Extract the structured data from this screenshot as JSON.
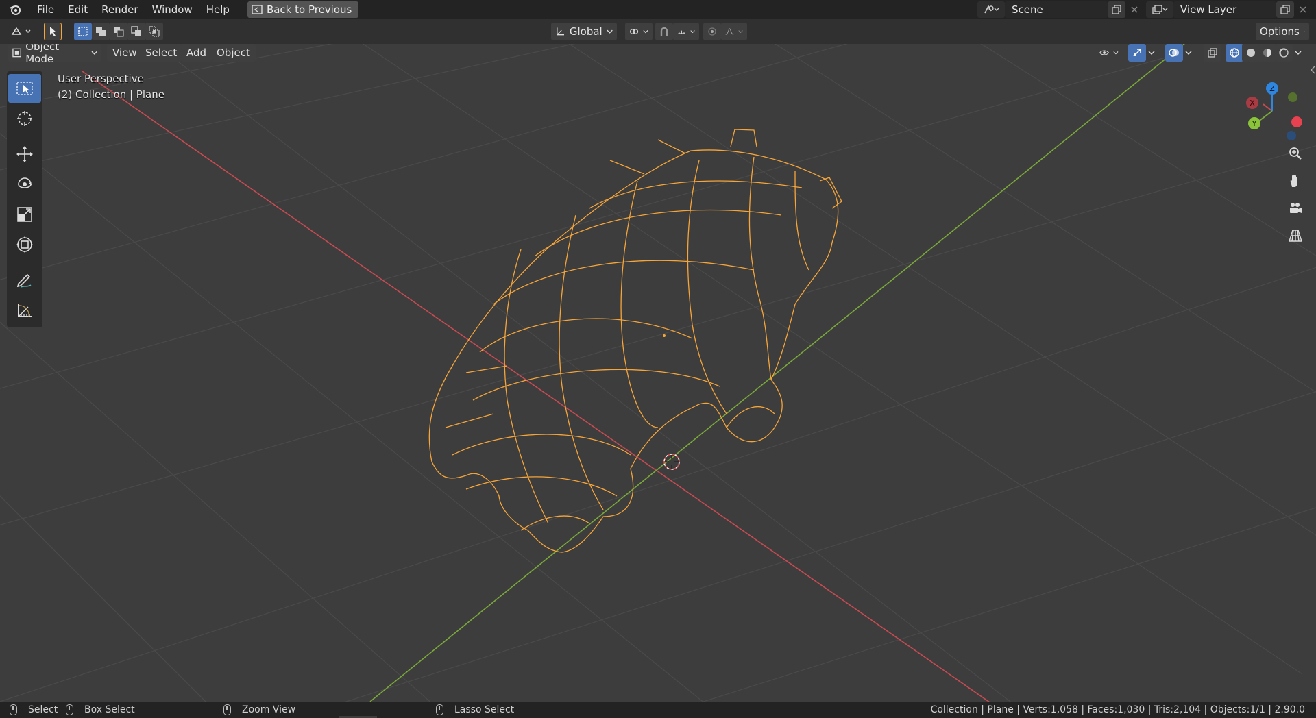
{
  "menu": {
    "items": [
      "File",
      "Edit",
      "Render",
      "Window",
      "Help"
    ],
    "back_button": "Back to Previous"
  },
  "scene": {
    "label": "Scene",
    "view_layer": "View Layer"
  },
  "toolrow": {
    "transform_orientation": "Global",
    "options": "Options"
  },
  "viewport_header": {
    "mode": "Object Mode",
    "menus": [
      "View",
      "Select",
      "Add",
      "Object"
    ]
  },
  "overlay": {
    "perspective": "User Perspective",
    "collection": "(2) Collection | Plane"
  },
  "gizmo": {
    "x": "X",
    "y": "Y",
    "z": "Z"
  },
  "colors": {
    "selection": "#f5a53a",
    "x_axis": "#c84a52",
    "y_axis": "#7aa83a",
    "z_axis": "#2f86e0",
    "accent": "#4772b3"
  },
  "status": {
    "select": "Select",
    "box_select": "Box Select",
    "zoom_view": "Zoom View",
    "lasso_select": "Lasso Select",
    "stats": "Collection | Plane | Verts:1,058 | Faces:1,030 | Tris:2,104 | Objects:1/1 | 2.90.0"
  }
}
